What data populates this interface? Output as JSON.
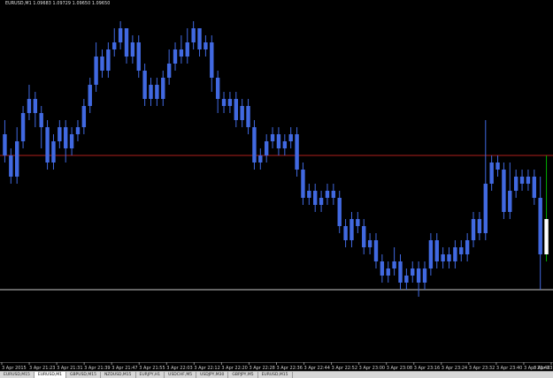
{
  "window": {
    "title": "EURUSD,M1  1.09683 1.09729 1.09650 1.09650"
  },
  "tabs": [
    {
      "label": "EURUSD,M15",
      "active": false
    },
    {
      "label": "EURUSD,M1",
      "active": true
    },
    {
      "label": "GBPUSD,M15",
      "active": false
    },
    {
      "label": "NZDUSD,M15",
      "active": false
    },
    {
      "label": "EURJPY,H1",
      "active": false
    },
    {
      "label": "USDCHF,M5",
      "active": false
    },
    {
      "label": "USDJPY,M30",
      "active": false
    },
    {
      "label": "GBPJPY,M5",
      "active": false
    },
    {
      "label": "EURUSD,M15",
      "active": false
    }
  ],
  "colors": {
    "background": "#000000",
    "candle_body": "#4169e1",
    "bullish_accent": "#00b000",
    "current_candle": "#ffffff",
    "bid_line": "#b0201c",
    "grid_line": "#c8c8c8"
  },
  "chart_data": {
    "type": "candlestick",
    "symbol": "EURUSD",
    "timeframe": "M1",
    "x_labels": [
      "3 Apr 2015",
      "3 Apr 21:23",
      "3 Apr 21:31",
      "3 Apr 21:39",
      "3 Apr 21:47",
      "3 Apr 21:55",
      "3 Apr 22:03",
      "3 Apr 22:12",
      "3 Apr 22:20",
      "3 Apr 22:28",
      "3 Apr 22:36",
      "3 Apr 22:44",
      "3 Apr 22:52",
      "3 Apr 23:00",
      "3 Apr 23:08",
      "3 Apr 23:16",
      "3 Apr 23:24",
      "3 Apr 23:32",
      "3 Apr 23:40",
      "3 Apr 23:48",
      "3 Apr 23:56"
    ],
    "ylim": [
      1.095,
      1.1
    ],
    "horizontal_lines": [
      1.0979,
      1.096
    ],
    "candles": [
      [
        1.0982,
        1.0979,
        1.0984,
        1.0978
      ],
      [
        1.0979,
        1.0976,
        1.098,
        1.0975
      ],
      [
        1.0976,
        1.0981,
        1.0983,
        1.0975
      ],
      [
        1.0981,
        1.0985,
        1.0986,
        1.098
      ],
      [
        1.0985,
        1.0987,
        1.0989,
        1.0984
      ],
      [
        1.0987,
        1.0985,
        1.0988,
        1.0983
      ],
      [
        1.0985,
        1.0983,
        1.0986,
        1.098
      ],
      [
        1.0983,
        1.0978,
        1.0984,
        1.0977
      ],
      [
        1.0978,
        1.0981,
        1.0982,
        1.0977
      ],
      [
        1.0981,
        1.0983,
        1.0984,
        1.098
      ],
      [
        1.0983,
        1.098,
        1.0984,
        1.0978
      ],
      [
        1.098,
        1.0982,
        1.0983,
        1.0979
      ],
      [
        1.0982,
        1.0983,
        1.0984,
        1.0981
      ],
      [
        1.0983,
        1.0986,
        1.0987,
        1.0982
      ],
      [
        1.0986,
        1.0989,
        1.099,
        1.0985
      ],
      [
        1.0989,
        1.0993,
        1.0995,
        1.0988
      ],
      [
        1.0993,
        1.0991,
        1.0994,
        1.099
      ],
      [
        1.0991,
        1.0994,
        1.0995,
        1.099
      ],
      [
        1.0994,
        1.0995,
        1.0997,
        1.0993
      ],
      [
        1.0995,
        1.0997,
        1.0998,
        1.0994
      ],
      [
        1.0997,
        1.0993,
        1.0997,
        1.0992
      ],
      [
        1.0993,
        1.0995,
        1.0996,
        1.0992
      ],
      [
        1.0995,
        1.0991,
        1.0996,
        1.099
      ],
      [
        1.0991,
        1.0987,
        1.0992,
        1.0986
      ],
      [
        1.0987,
        1.0989,
        1.099,
        1.0986
      ],
      [
        1.0989,
        1.0987,
        1.099,
        1.0986
      ],
      [
        1.0987,
        1.099,
        1.0991,
        1.0986
      ],
      [
        1.099,
        1.0992,
        1.0994,
        1.0989
      ],
      [
        1.0992,
        1.0994,
        1.0995,
        1.0991
      ],
      [
        1.0994,
        1.0993,
        1.0996,
        1.0992
      ],
      [
        1.0993,
        1.0995,
        1.0997,
        1.0992
      ],
      [
        1.0995,
        1.0997,
        1.0998,
        1.0994
      ],
      [
        1.0997,
        1.0994,
        1.0997,
        1.0993
      ],
      [
        1.0994,
        1.0995,
        1.0996,
        1.0993
      ],
      [
        1.0995,
        1.099,
        1.0996,
        1.0988
      ],
      [
        1.099,
        1.0987,
        1.0991,
        1.0985
      ],
      [
        1.0987,
        1.0986,
        1.0988,
        1.0985
      ],
      [
        1.0986,
        1.0987,
        1.0988,
        1.0985
      ],
      [
        1.0987,
        1.0984,
        1.0988,
        1.0983
      ],
      [
        1.0984,
        1.0986,
        1.0987,
        1.0983
      ],
      [
        1.0986,
        1.0983,
        1.0987,
        1.0982
      ],
      [
        1.0983,
        1.0978,
        1.0984,
        1.0977
      ],
      [
        1.0978,
        1.0979,
        1.098,
        1.0977
      ],
      [
        1.0979,
        1.0981,
        1.0982,
        1.0978
      ],
      [
        1.0981,
        1.0982,
        1.0983,
        1.098
      ],
      [
        1.0982,
        1.098,
        1.0983,
        1.0979
      ],
      [
        1.098,
        1.0981,
        1.0982,
        1.0979
      ],
      [
        1.0981,
        1.0982,
        1.0983,
        1.098
      ],
      [
        1.0982,
        1.0977,
        1.0983,
        1.0976
      ],
      [
        1.0977,
        1.0973,
        1.0978,
        1.0972
      ],
      [
        1.0973,
        1.0974,
        1.0975,
        1.0972
      ],
      [
        1.0974,
        1.0972,
        1.0975,
        1.0971
      ],
      [
        1.0972,
        1.0973,
        1.0974,
        1.0971
      ],
      [
        1.0973,
        1.0974,
        1.0975,
        1.0972
      ],
      [
        1.0974,
        1.0973,
        1.0975,
        1.0972
      ],
      [
        1.0973,
        1.0969,
        1.0974,
        1.0968
      ],
      [
        1.0969,
        1.0967,
        1.097,
        1.0966
      ],
      [
        1.0967,
        1.097,
        1.0971,
        1.0966
      ],
      [
        1.097,
        1.0969,
        1.0971,
        1.0968
      ],
      [
        1.0969,
        1.0966,
        1.097,
        1.0965
      ],
      [
        1.0966,
        1.0967,
        1.0968,
        1.0965
      ],
      [
        1.0967,
        1.0964,
        1.0968,
        1.0963
      ],
      [
        1.0964,
        1.0962,
        1.0965,
        1.0961
      ],
      [
        1.0962,
        1.0963,
        1.0964,
        1.0961
      ],
      [
        1.0963,
        1.0964,
        1.0966,
        1.0962
      ],
      [
        1.0964,
        1.0961,
        1.0965,
        1.096
      ],
      [
        1.0961,
        1.0962,
        1.0963,
        1.096
      ],
      [
        1.0962,
        1.0963,
        1.0964,
        1.0961
      ],
      [
        1.0963,
        1.0961,
        1.0964,
        1.0959
      ],
      [
        1.0961,
        1.0963,
        1.0964,
        1.096
      ],
      [
        1.0963,
        1.0967,
        1.0968,
        1.0962
      ],
      [
        1.0967,
        1.0964,
        1.0968,
        1.0963
      ],
      [
        1.0964,
        1.0965,
        1.0966,
        1.0963
      ],
      [
        1.0965,
        1.0964,
        1.0966,
        1.0963
      ],
      [
        1.0964,
        1.0966,
        1.0967,
        1.0963
      ],
      [
        1.0966,
        1.0965,
        1.0967,
        1.0964
      ],
      [
        1.0965,
        1.0967,
        1.0968,
        1.0964
      ],
      [
        1.0967,
        1.097,
        1.0971,
        1.0966
      ],
      [
        1.097,
        1.0968,
        1.0971,
        1.0967
      ],
      [
        1.0968,
        1.0975,
        1.0984,
        1.0967
      ],
      [
        1.0975,
        1.0978,
        1.0979,
        1.0974
      ],
      [
        1.0978,
        1.0977,
        1.0979,
        1.0976
      ],
      [
        1.0977,
        1.0971,
        1.0978,
        1.097
      ],
      [
        1.0971,
        1.0974,
        1.0978,
        1.097
      ],
      [
        1.0974,
        1.0976,
        1.0977,
        1.0973
      ],
      [
        1.0976,
        1.0975,
        1.0977,
        1.0974
      ],
      [
        1.0975,
        1.0976,
        1.0977,
        1.0974
      ],
      [
        1.0976,
        1.0973,
        1.0977,
        1.0972
      ],
      [
        1.0973,
        1.0965,
        1.0976,
        1.096
      ],
      [
        1.0965,
        1.097,
        1.0979,
        1.0964
      ]
    ]
  }
}
